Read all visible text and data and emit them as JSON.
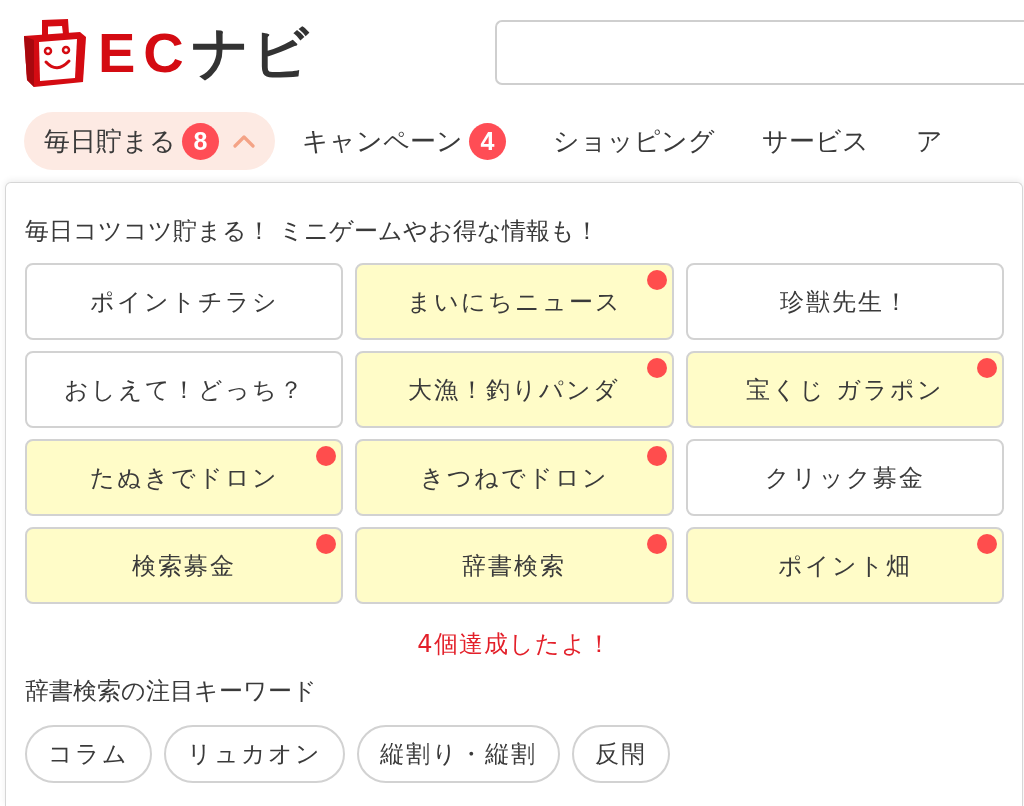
{
  "logo": {
    "wordmark": [
      "EC",
      "ナビ"
    ]
  },
  "nav": {
    "tabs": [
      {
        "label": "毎日貯まる",
        "badge": "8",
        "selected": true
      },
      {
        "label": "キャンペーン",
        "badge": "4",
        "selected": false
      },
      {
        "label": "ショッピング",
        "selected": false
      },
      {
        "label": "サービス",
        "selected": false
      },
      {
        "label": "ア",
        "selected": false
      }
    ]
  },
  "menu_panel": {
    "intro": "毎日コツコツ貯まる！ ミニゲームやお得な情報も！",
    "games": [
      {
        "label": "ポイントチラシ",
        "completed": true
      },
      {
        "label": "まいにちニュース",
        "completed": false
      },
      {
        "label": "珍獣先生！",
        "completed": true
      },
      {
        "label": "おしえて！どっち？",
        "completed": true
      },
      {
        "label": "大漁！釣りパンダ",
        "completed": false
      },
      {
        "label": "宝くじ ガラポン",
        "completed": false
      },
      {
        "label": "たぬきでドロン",
        "completed": false
      },
      {
        "label": "きつねでドロン",
        "completed": false
      },
      {
        "label": "クリック募金",
        "completed": true
      },
      {
        "label": "検索募金",
        "completed": false
      },
      {
        "label": "辞書検索",
        "completed": false
      },
      {
        "label": "ポイント畑",
        "completed": false
      }
    ],
    "achievement": "4個達成したよ！",
    "keywords_heading": "辞書検索の注目キーワード",
    "keywords": [
      "コラム",
      "リュカオン",
      "縦割り・縦割",
      "反閇"
    ]
  }
}
